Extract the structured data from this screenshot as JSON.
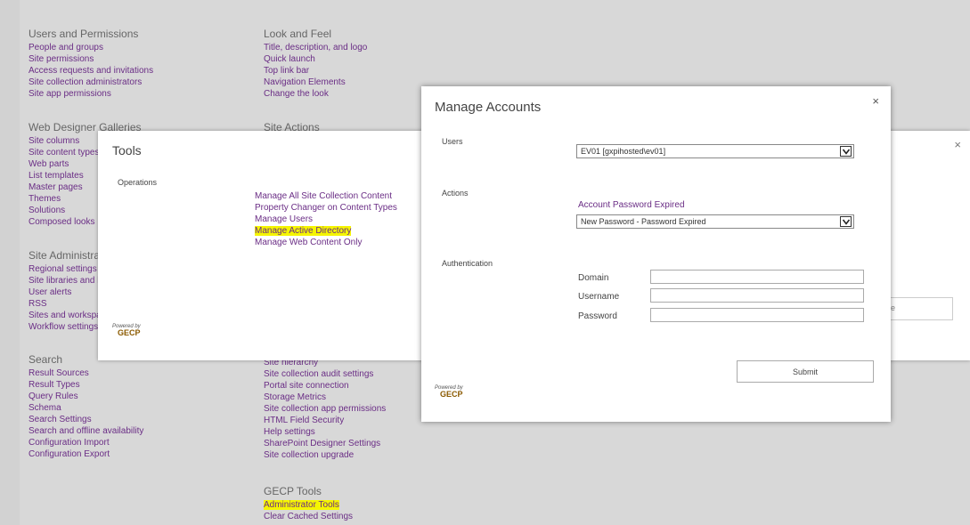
{
  "background": {
    "users_permissions": {
      "title": "Users and Permissions",
      "links": [
        "People and groups",
        "Site permissions",
        "Access requests and invitations",
        "Site collection administrators",
        "Site app permissions"
      ]
    },
    "look_feel": {
      "title": "Look and Feel",
      "links": [
        "Title, description, and logo",
        "Quick launch",
        "Top link bar",
        "Navigation Elements",
        "Change the look"
      ]
    },
    "web_designer": {
      "title": "Web Designer Galleries",
      "links": [
        "Site columns",
        "Site content types",
        "Web parts",
        "List templates",
        "Master pages",
        "Themes",
        "Solutions",
        "Composed looks"
      ]
    },
    "site_actions": {
      "title": "Site Actions"
    },
    "site_admin": {
      "title": "Site Administrat",
      "links": [
        "Regional settings",
        "Site libraries and l",
        "User alerts",
        "RSS",
        "Sites and workspa",
        "Workflow settings"
      ]
    },
    "search": {
      "title": "Search",
      "links": [
        "Result Sources",
        "Result Types",
        "Query Rules",
        "Schema",
        "Search Settings",
        "Search and offline availability",
        "Configuration Import",
        "Configuration Export"
      ]
    },
    "site_collection": {
      "links": [
        "Site hierarchy",
        "Site collection audit settings",
        "Portal site connection",
        "Storage Metrics",
        "Site collection app permissions",
        "HTML Field Security",
        "Help settings",
        "SharePoint Designer Settings",
        "Site collection upgrade"
      ]
    },
    "gecp_tools": {
      "title": "GECP Tools",
      "links": [
        "Administrator Tools",
        "Clear Cached Settings"
      ]
    }
  },
  "tools_dialog": {
    "title": "Tools",
    "close": "×",
    "operations_label": "Operations",
    "links": [
      "Manage All Site Collection Content",
      "Property Changer on Content Types",
      "Manage Users",
      "Manage Active Directory",
      "Manage Web Content Only"
    ],
    "ghost_input_text": "e",
    "powered_by": "Powered by",
    "brand": "GECP"
  },
  "manage_dialog": {
    "title": "Manage Accounts",
    "close": "×",
    "users_label": "Users",
    "users_value": "EV01 [gxpihosted\\ev01]",
    "actions_label": "Actions",
    "action_heading": "Account Password Expired",
    "action_value": "New Password - Password Expired",
    "authentication_label": "Authentication",
    "domain_label": "Domain",
    "username_label": "Username",
    "password_label": "Password",
    "submit_label": "Submit",
    "powered_by": "Powered by",
    "brand": "GECP"
  },
  "colors": {
    "link": "#6a2d85",
    "highlight": "#f5f500",
    "overlay_bg": "#d8d8d8"
  }
}
